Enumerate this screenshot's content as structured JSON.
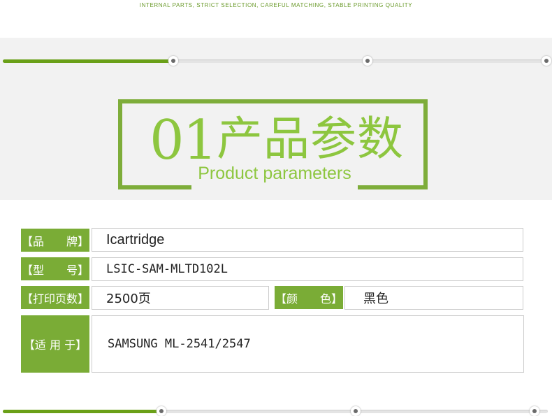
{
  "header": {
    "tagline": "INTERNAL PARTS, STRICT SELECTION, CAREFUL MATCHING, STABLE PRINTING QUALITY"
  },
  "top_progress": {
    "filled_fraction": 0.31,
    "steps": 3,
    "active_step": 1
  },
  "section": {
    "number": "01",
    "title_cn": "产品参数",
    "title_en": "Product parameters"
  },
  "specs": {
    "brand_label": "【品　　牌】",
    "brand_value": "Icartridge",
    "model_label": "【型　　号】",
    "model_value": "LSIC-SAM-MLTD102L",
    "pages_label": "【打印页数】",
    "pages_value": "2500页",
    "color_label": "【颜　　色】",
    "color_value": "黑色",
    "compat_label": "【适 用 于】",
    "compat_value": "SAMSUNG ML-2541/2547"
  },
  "bottom_progress": {
    "filled_fraction": 0.28,
    "steps": 3
  },
  "colors": {
    "accent": "#7aac36",
    "title_green": "#8dc63f",
    "progress_green": "#6aa018",
    "band_gray": "#f2f2f2"
  }
}
